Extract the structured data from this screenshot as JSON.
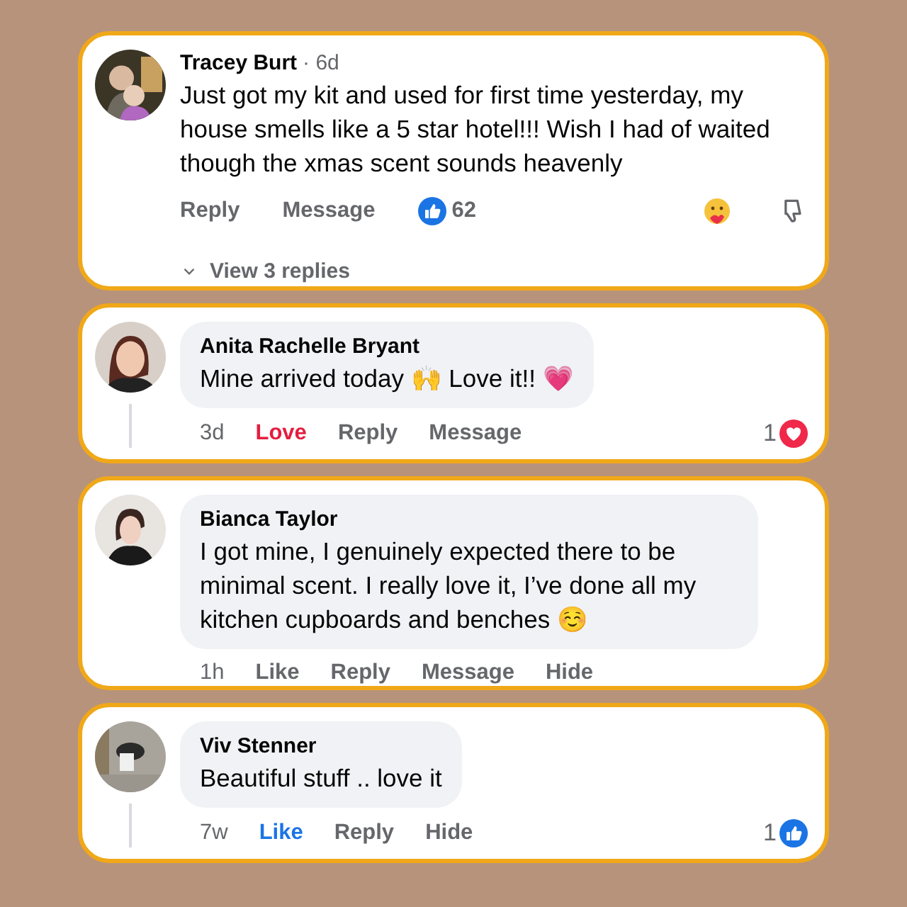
{
  "comments": [
    {
      "kind": "plain",
      "name": "Tracey Burt",
      "time": "· 6d",
      "text": "Just got my kit and used for first time yesterday, my house smells like a 5 star hotel!!! Wish I had of waited though the xmas scent sounds heavenly",
      "thread_line": false,
      "actions": [
        {
          "label": "Reply",
          "kind": "plain"
        },
        {
          "label": "Message",
          "kind": "plain"
        }
      ],
      "reaction": {
        "kind": "like",
        "count": "62"
      },
      "replies_link": "View 3 replies"
    },
    {
      "kind": "bubble",
      "name": "Anita Rachelle Bryant",
      "time": "3d",
      "text": "Mine arrived today 🙌 Love it!! 💗",
      "thread_line": true,
      "actions": [
        {
          "label": "Love",
          "kind": "love",
          "selected": true
        },
        {
          "label": "Reply",
          "kind": "plain"
        },
        {
          "label": "Message",
          "kind": "plain"
        }
      ],
      "reaction": {
        "kind": "love",
        "count": "1"
      }
    },
    {
      "kind": "bubble",
      "name": "Bianca Taylor",
      "time": "1h",
      "text": "I got mine, I genuinely expected there to be minimal scent. I really love it, I’ve done all my kitchen cupboards and benches ☺️",
      "thread_line": false,
      "actions": [
        {
          "label": "Like",
          "kind": "like",
          "selected": false
        },
        {
          "label": "Reply",
          "kind": "plain"
        },
        {
          "label": "Message",
          "kind": "plain"
        },
        {
          "label": "Hide",
          "kind": "plain"
        }
      ]
    },
    {
      "kind": "bubble",
      "name": "Viv Stenner",
      "time": "7w",
      "text": "Beautiful stuff .. love it",
      "thread_line": true,
      "actions": [
        {
          "label": "Like",
          "kind": "like",
          "selected": true
        },
        {
          "label": "Reply",
          "kind": "plain"
        },
        {
          "label": "Hide",
          "kind": "plain"
        }
      ],
      "reaction": {
        "kind": "like",
        "count": "1"
      }
    }
  ]
}
